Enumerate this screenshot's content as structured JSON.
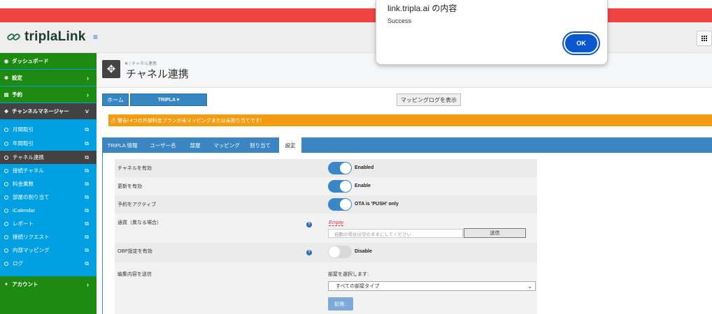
{
  "header": {
    "brand": "triplaLink",
    "hamburger": "≡",
    "grid": "⋮⋮⋮"
  },
  "sidebar": {
    "top_items": [
      {
        "label": "ダッシュボード",
        "icon": "dashboard-icon"
      },
      {
        "label": "設定",
        "icon": "gear-icon"
      },
      {
        "label": "予約",
        "icon": "reservation-icon"
      },
      {
        "label": "チャンネルマネージャー",
        "icon": "move-icon"
      }
    ],
    "sub_items": [
      {
        "label": "月間取引"
      },
      {
        "label": "年間取引"
      },
      {
        "label": "チャネル連携"
      },
      {
        "label": "接続チャネル"
      },
      {
        "label": "料金乗数"
      },
      {
        "label": "部屋の割り当て"
      },
      {
        "label": "iCalendar"
      },
      {
        "label": "レポート"
      },
      {
        "label": "接続リクエスト"
      },
      {
        "label": "内部マッピング"
      },
      {
        "label": "ログ"
      }
    ],
    "account": {
      "label": "アカウント",
      "icon": "user-icon"
    }
  },
  "page": {
    "breadcrumb": "✥ / チャネル連携",
    "title": "チャネル連携"
  },
  "toolbar": {
    "home": "ホーム",
    "tripla": "TRIPLA ▾",
    "mapping_log": "マッピングログを表示"
  },
  "warning": "⚠ 警告! 4つの外部料金プランが未マッピングまたは未割り当てです!",
  "tabs": [
    "TRIPLA 情報",
    "ユーザー名",
    "部屋",
    "マッピング",
    "割り当て",
    "設定"
  ],
  "settings": {
    "channel_enabled": {
      "label": "チャネルを有効",
      "state": "Enabled"
    },
    "update_enabled": {
      "label": "更新を有効",
      "state": "Enable"
    },
    "reservation_active": {
      "label": "予約をアクティブ",
      "state": "OTA is 'PUSH' only"
    },
    "currency": {
      "label": "通貨（異なる場合）",
      "empty": "Empty",
      "placeholder": "自動の場合は空のままにしてください",
      "send": "送信"
    },
    "obp": {
      "label": "OBP設定を有効",
      "state": "Disable"
    },
    "send_edits": {
      "label": "編集内容を送信",
      "room_label": "部屋を選択します:",
      "room_value": "すべての部屋タイプ",
      "process": "処理.."
    }
  },
  "dialog": {
    "title": "link.tripla.ai の内容",
    "message": "Success",
    "ok": "OK"
  },
  "colors": {
    "red_bar": "#ef4344",
    "sidebar_green": "#1f8a11",
    "sidebar_blue": "#00a0e3",
    "tab_blue": "#3a85c2",
    "warning": "#f39c12",
    "ok_button": "#0b57d0"
  }
}
